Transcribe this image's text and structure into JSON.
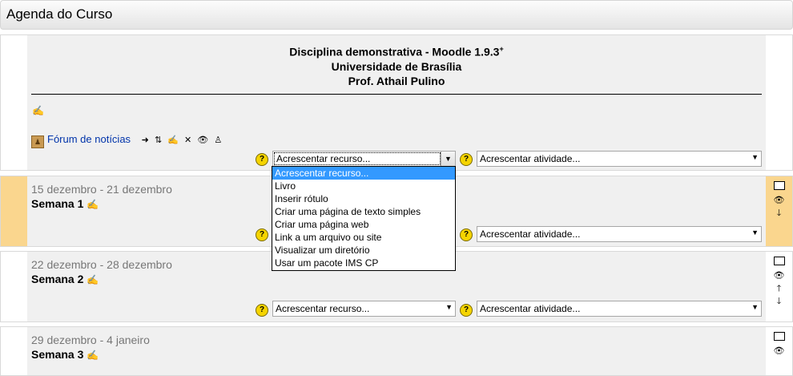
{
  "header": {
    "title": "Agenda do Curso"
  },
  "summary": {
    "line1": "Disciplina demonstrativa - Moodle 1.9.3",
    "line1_sup": "+",
    "line2": "Universidade de Brasília",
    "line3": "Prof. Athail Pulino"
  },
  "forum": {
    "label": "Fórum de notícias"
  },
  "selects": {
    "add_resource": "Acrescentar recurso...",
    "add_activity": "Acrescentar atividade..."
  },
  "resource_options": [
    "Acrescentar recurso...",
    "Livro",
    "Inserir rótulo",
    "Criar uma página de texto simples",
    "Criar uma página web",
    "Link a um arquivo ou site",
    "Visualizar um diretório",
    "Usar um pacote IMS CP"
  ],
  "weeks": [
    {
      "dates": "15 dezembro - 21 dezembro",
      "title": "Semana 1"
    },
    {
      "dates": "22 dezembro - 28 dezembro",
      "title": "Semana 2"
    },
    {
      "dates": "29 dezembro - 4 janeiro",
      "title": "Semana 3"
    }
  ],
  "colors": {
    "current_week": "#fad68e",
    "section_bg": "#f0f0f0",
    "link": "#0033aa",
    "selected_option": "#3399ff"
  }
}
